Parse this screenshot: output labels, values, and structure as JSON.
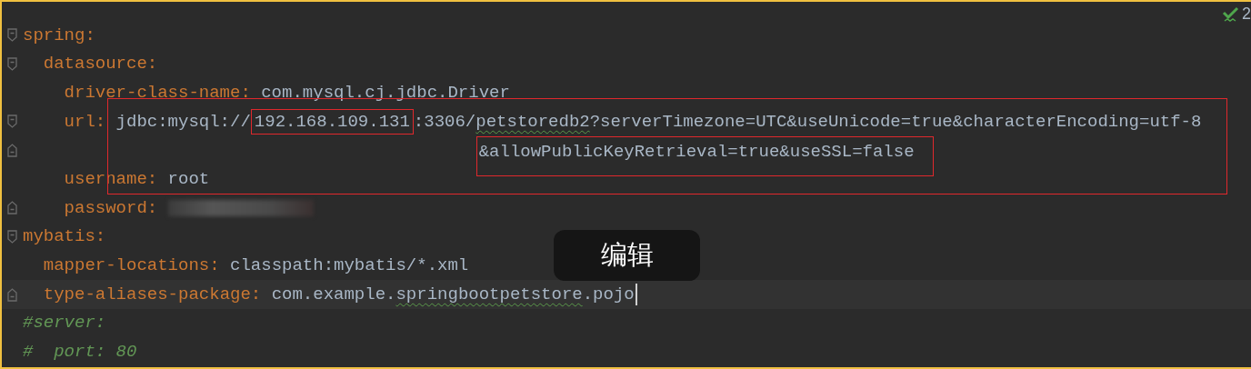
{
  "inspection": {
    "count": "2"
  },
  "lines": [
    {
      "key": "spring:",
      "fold_start": true,
      "children": [
        {
          "key": "datasource:",
          "fold_start": true,
          "children": [
            {
              "key": "driver-class-name:",
              "value": [
                {
                  "text": "com.mysql.cj.jdbc.Driver"
                }
              ]
            },
            {
              "key": "url:",
              "fold_start": true,
              "value": [
                {
                  "text": "jdbc:mysql://"
                },
                {
                  "text": "192.168.109.131",
                  "boxed": true
                },
                {
                  "text": ":3306/"
                },
                {
                  "text": "petstoredb2",
                  "misspelled": true
                },
                {
                  "text": "?serverTimezone=UTC&useUnicode=true&characterEncoding=utf-8"
                }
              ],
              "continuation": {
                "fold_end": true,
                "value": [
                  {
                    "text": "&allowPublicKeyRetrieval=true&useSSL=false",
                    "boxed": true
                  }
                ]
              }
            },
            {
              "key": "username:",
              "value": [
                {
                  "text": "root"
                }
              ]
            },
            {
              "key": "password:",
              "fold_end": true,
              "redacted": true
            }
          ]
        }
      ]
    },
    {
      "key": "mybatis:",
      "fold_start": true,
      "children": [
        {
          "key": "mapper-locations:",
          "value": [
            {
              "text": "classpath:mybatis/*.xml"
            }
          ]
        },
        {
          "key": "type-aliases-package:",
          "fold_end": true,
          "current": true,
          "value": [
            {
              "text": "com.example."
            },
            {
              "text": "springbootpetstore",
              "misspelled": true
            },
            {
              "text": ".pojo"
            }
          ]
        }
      ]
    },
    {
      "comment": "#server:"
    },
    {
      "comment": "#  port: 80"
    }
  ],
  "tooltip": {
    "text": "编辑"
  }
}
